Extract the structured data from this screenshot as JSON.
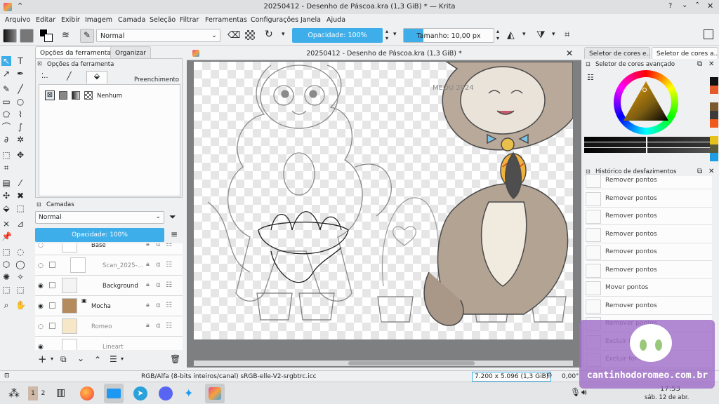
{
  "window": {
    "title": "20250412 - Desenho de Páscoa.kra (1,3 GiB) * — Krita"
  },
  "menu": [
    "Arquivo",
    "Editar",
    "Exibir",
    "Imagem",
    "Camada",
    "Seleção",
    "Filtrar",
    "Ferramentas",
    "Configurações",
    "Janela",
    "Ajuda"
  ],
  "toolbar": {
    "blend_mode": "Normal",
    "opacity_label": "Opacidade: 100%",
    "size_label": "Tamanho: 10,00 px",
    "size_fill_fraction": 0.22
  },
  "tool_options": {
    "tabs": [
      "Opções da ferramenta",
      "Organizar"
    ],
    "header": "Opções da ferramenta",
    "fill_label": "Preenchimento",
    "fill_option": "Nenhum"
  },
  "layers": {
    "header": "Camadas",
    "blend_mode": "Normal",
    "opacity_label": "Opacidade:  100%",
    "rows": [
      {
        "name": "Base",
        "visible": false
      },
      {
        "name": "Scan_2025-...",
        "visible": false
      },
      {
        "name": "Background",
        "visible": true
      },
      {
        "name": "Mocha",
        "visible": true
      },
      {
        "name": "Romeo",
        "visible": false
      },
      {
        "name": "Lineart",
        "visible": true
      }
    ]
  },
  "canvas": {
    "title": "20250412 - Desenho de Páscoa.kra (1,3 GiB) *",
    "signature": "MEOU 2024"
  },
  "right_panel": {
    "tabs": [
      "Seletor de cores e...",
      "Seletor de cores a..."
    ],
    "color_selector_title": "Seletor de cores avançado",
    "history_title": "Histórico de desfazimentos",
    "history": [
      "Remover pontos",
      "Remover pontos",
      "Remover pontos",
      "Remover pontos",
      "Remover pontos",
      "Remover pontos",
      "Mover pontos",
      "Remover pontos",
      "Remover pontos",
      "Excluir forma",
      "Excluir forma"
    ],
    "swatches": [
      "#111111",
      "#e35a2b",
      "#7a5a2e",
      "#3b3b3b",
      "#f05a1e",
      "#e8c21c",
      "#5a5a3c",
      "#1e9de6",
      "#ffffff"
    ]
  },
  "status": {
    "color_info": "RGB/Alfa (8-bits inteiros/canal)  sRGB-elle-V2-srgbtrc.icc",
    "dims": "7.200 x 5.096 (1,3 GiB)",
    "rotation": "0,00°"
  },
  "taskbar": {
    "desktops": [
      "1",
      "2"
    ],
    "time": "17:53",
    "date": "sáb. 12 de abr."
  },
  "watermark": {
    "text": "cantinhodoromeo.com.br"
  }
}
